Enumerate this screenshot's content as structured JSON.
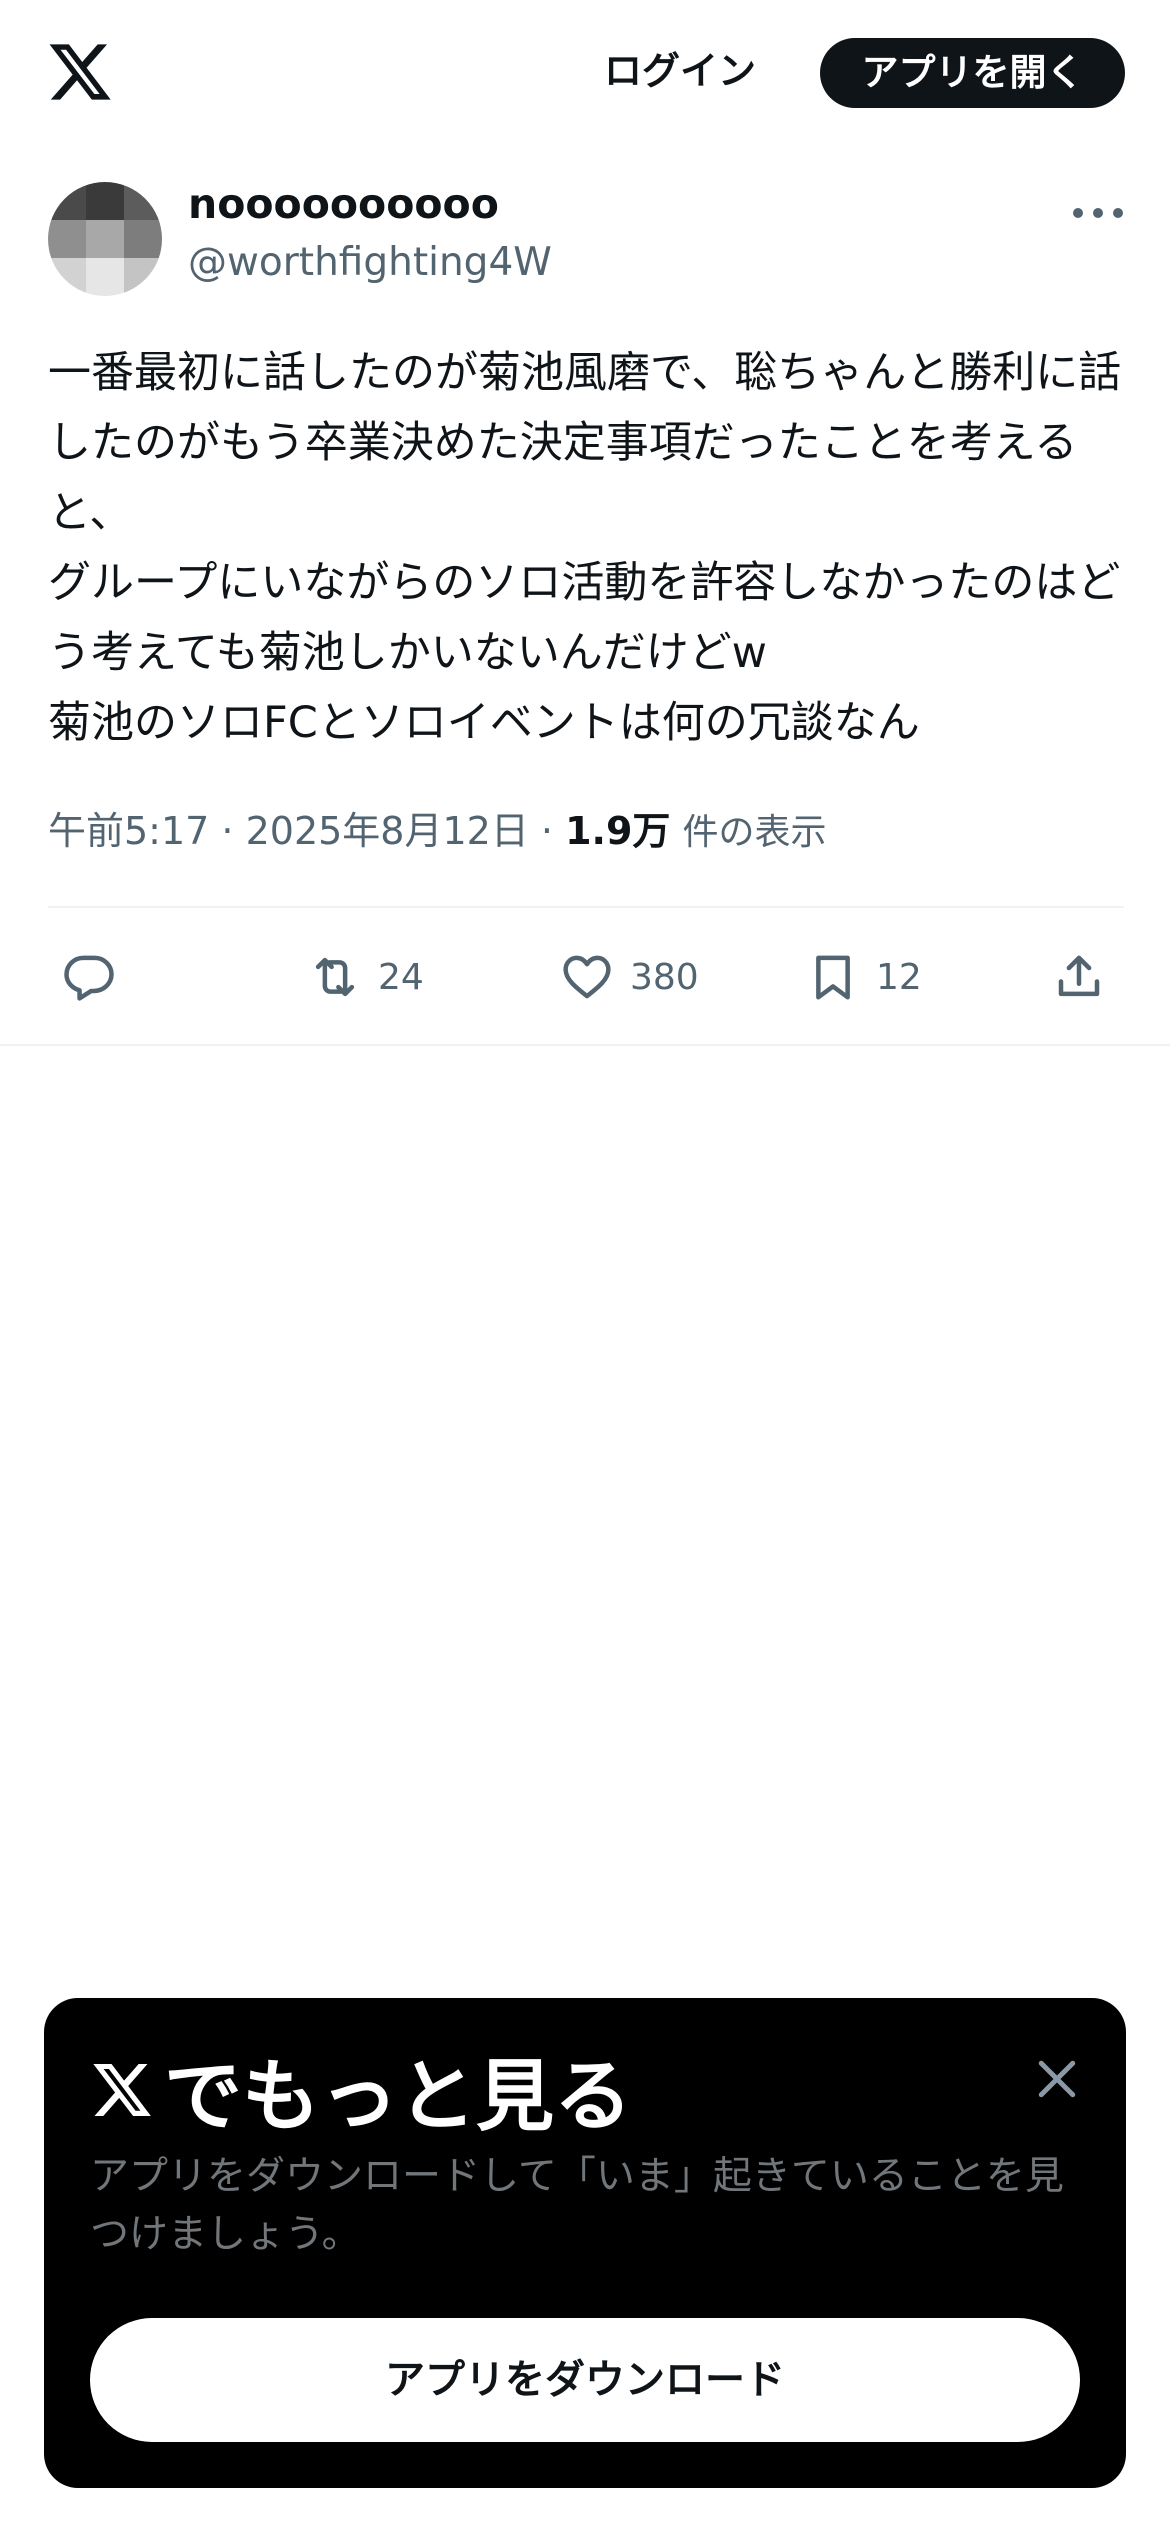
{
  "header": {
    "logo_icon": "x-logo-icon",
    "login_label": "ログイン",
    "open_app_label": "アプリを開く"
  },
  "post": {
    "author": {
      "display_name": "noooooooooo",
      "handle": "@worthfighting4W",
      "avatar_colors": [
        "#4a4a4a",
        "#3a3a3a",
        "#5c5c5c",
        "#8f8f8f",
        "#a8a8a8",
        "#7d7d7d",
        "#d2d2d2",
        "#e6e6e6",
        "#c4c4c4"
      ]
    },
    "more_icon": "more-horizontal-icon",
    "text": "一番最初に話したのが菊池風磨で、聡ちゃんと勝利に話したのがもう卒業決めた決定事項だったことを考えると、\nグループにいながらのソロ活動を許容しなかったのはどう考えても菊池しかいないんだけどw\n菊池のソロFCとソロイベントは何の冗談なん",
    "time": "午前5:17",
    "separator_1": " · ",
    "date": "2025年8月12日",
    "separator_2": " · ",
    "views_count": "1.9万",
    "views_label": "件の表示"
  },
  "actions": {
    "reply": {
      "icon": "reply-icon",
      "count": ""
    },
    "repost": {
      "icon": "repost-icon",
      "count": "24"
    },
    "like": {
      "icon": "heart-icon",
      "count": "380"
    },
    "bookmark": {
      "icon": "bookmark-icon",
      "count": "12"
    },
    "share": {
      "icon": "share-icon",
      "count": ""
    }
  },
  "promo": {
    "title": "でもっと見る",
    "close_icon": "close-icon",
    "description": "アプリをダウンロードして「いま」起きていることを見つけましょう。",
    "download_label": "アプリをダウンロード"
  },
  "colors": {
    "text_primary": "#0f1419",
    "text_secondary": "#536471",
    "divider": "#eff3f4",
    "promo_bg": "#000000",
    "promo_desc": "#71767b"
  }
}
